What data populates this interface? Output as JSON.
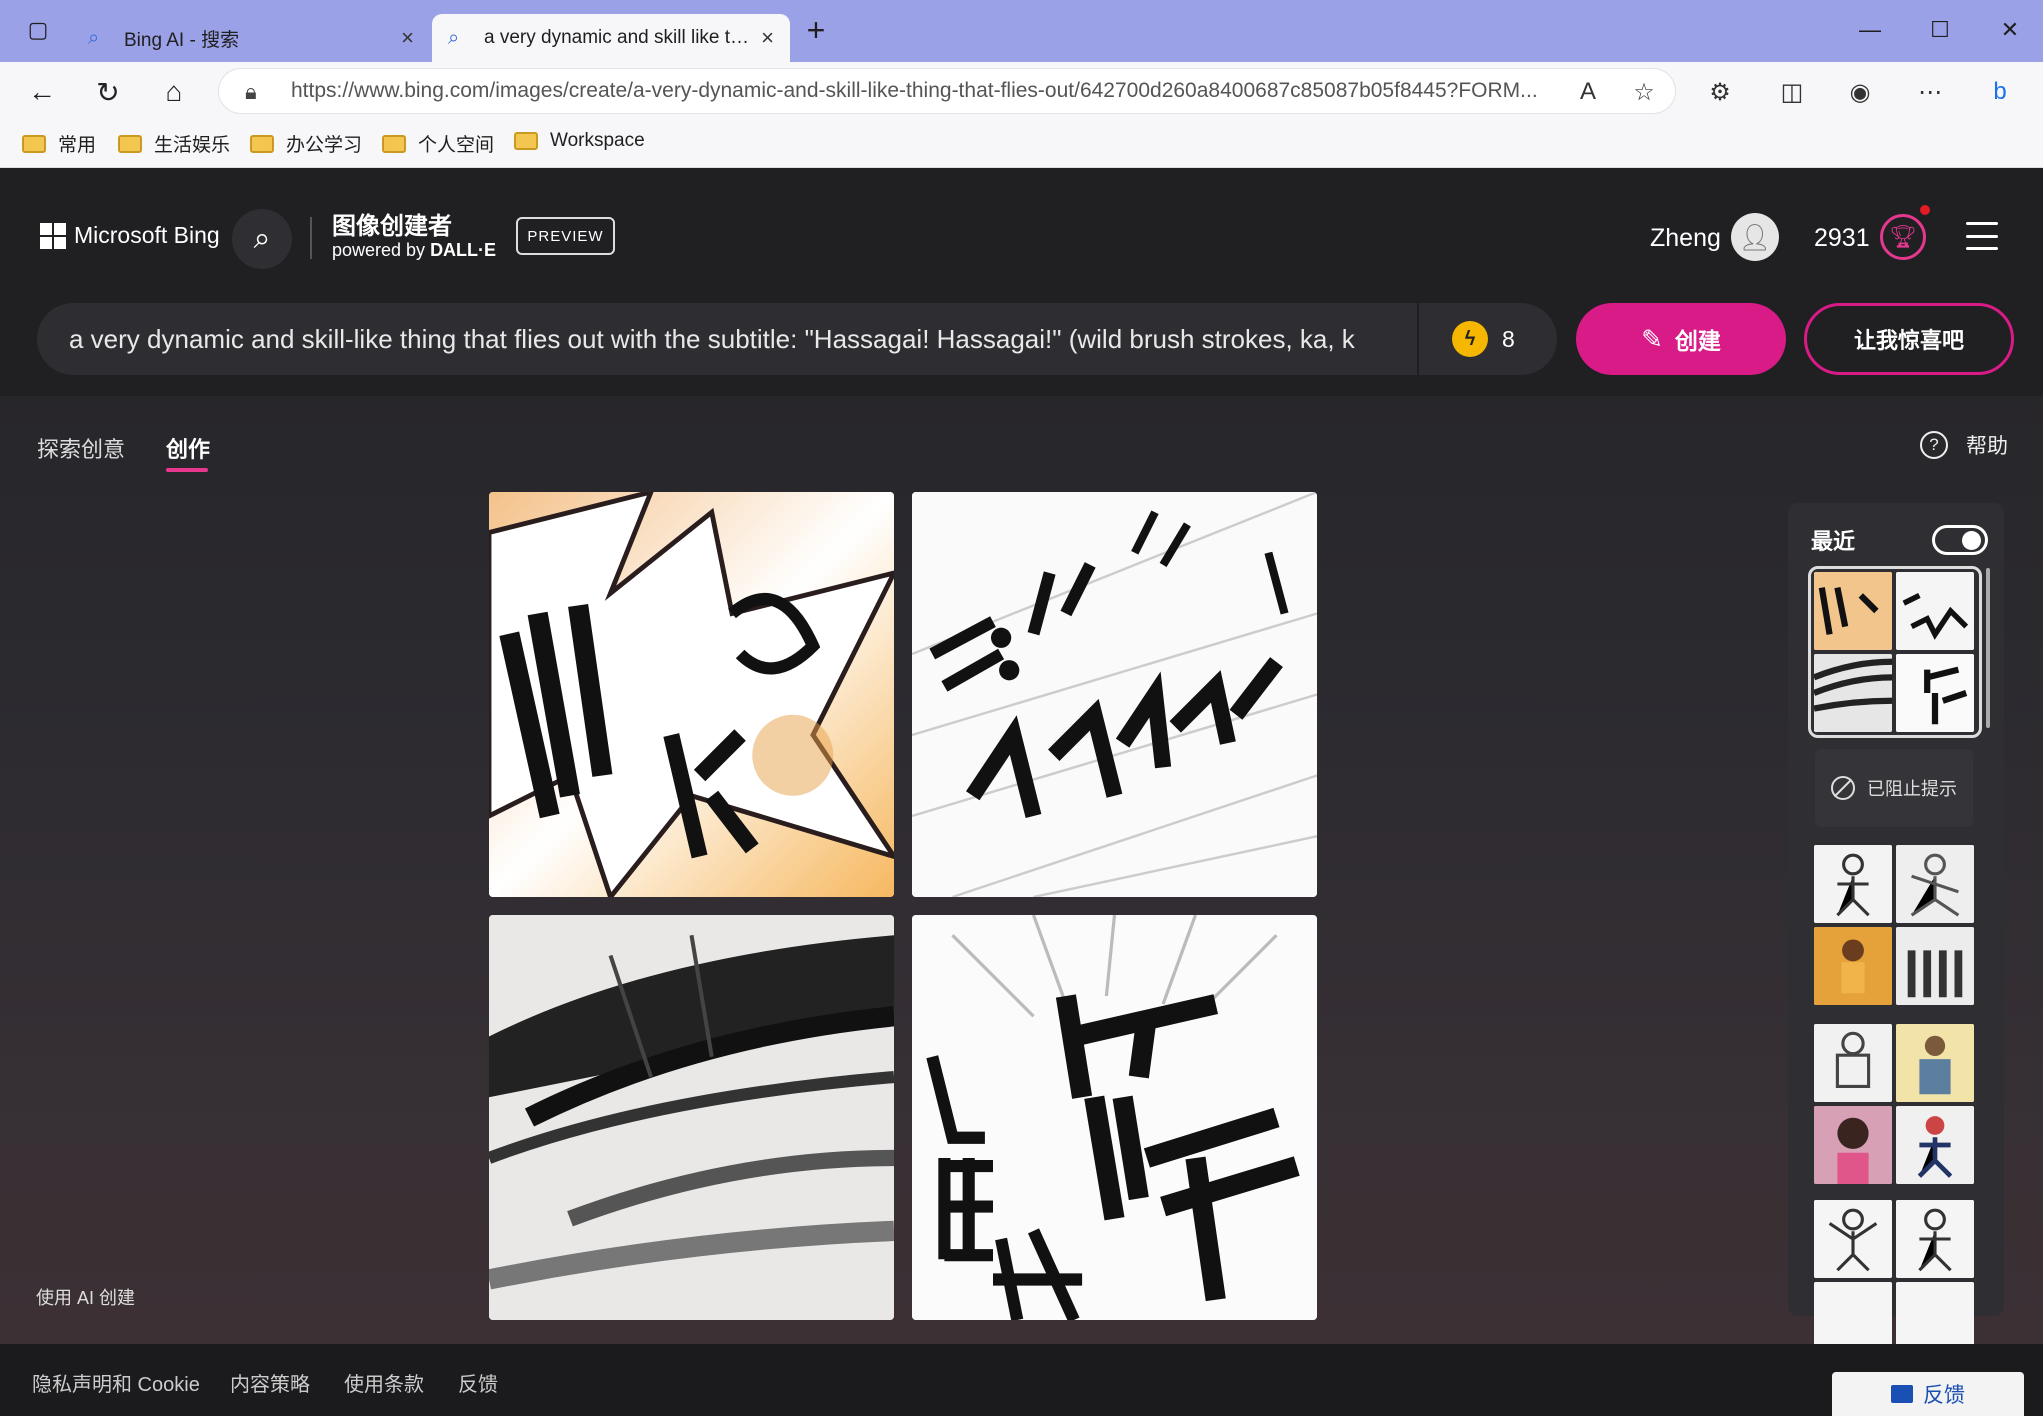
{
  "browser": {
    "tabs": [
      {
        "title": "Bing AI - 搜索",
        "icon": "search-icon"
      },
      {
        "title": "a very dynamic and skill like thing that flies out",
        "icon": "search-icon"
      }
    ],
    "new_tab": "+",
    "url": "https://www.bing.com/images/create/a-very-dynamic-and-skill-like-thing-that-flies-out/642700d260a8400687c85087b05f8445?FORM...",
    "favorites": [
      "常用",
      "生活娱乐",
      "办公学习",
      "个人空间",
      "Workspace"
    ]
  },
  "header": {
    "logo_text": "Microsoft Bing",
    "creator_title": "图像创建者",
    "powered_prefix": "powered by ",
    "powered_brand": "DALL·E",
    "preview_badge": "PREVIEW",
    "user_name": "Zheng",
    "points": "2931"
  },
  "prompt": {
    "text": "a very dynamic and skill-like thing that flies out with the subtitle: \"Hassagai! Hassagai!\" (wild brush strokes, ka, k",
    "boosts": "8",
    "create_label": "创建",
    "surprise_label": "让我惊喜吧"
  },
  "tabs": {
    "explore": "探索创意",
    "create": "创作",
    "help": "帮助"
  },
  "recent": {
    "title": "最近",
    "toggle_on": true,
    "blocked_label": "已阻止提示"
  },
  "ai_note": "使用 AI 创建",
  "footer": {
    "links": [
      "隐私声明和 Cookie",
      "内容策略",
      "使用条款",
      "反馈"
    ],
    "feedback_button": "反馈"
  },
  "colors": {
    "accent": "#d81b87",
    "tabbar": "#9ba1e6",
    "page_bg": "#242326"
  }
}
